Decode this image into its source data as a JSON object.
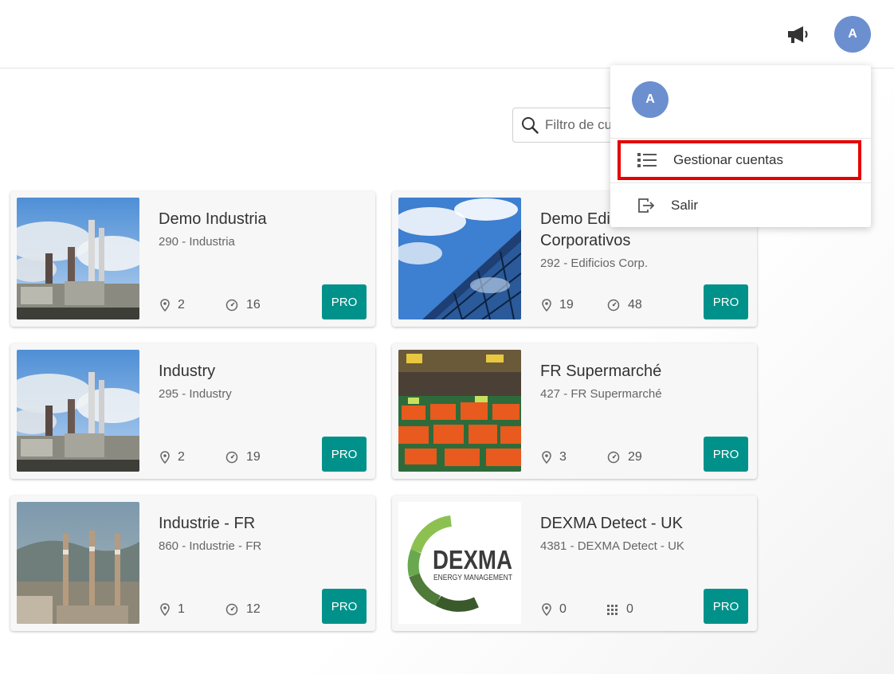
{
  "header": {
    "announcements_icon": "megaphone-icon",
    "avatar_initial": "A",
    "avatar_color": "#6c8fd0"
  },
  "filter": {
    "placeholder": "Filtro de cuentas",
    "value": ""
  },
  "user_menu": {
    "avatar_initial": "A",
    "items": [
      {
        "label": "Gestionar cuentas",
        "icon": "list-icon",
        "highlighted": true
      },
      {
        "label": "Salir",
        "icon": "logout-icon",
        "highlighted": false
      }
    ],
    "highlight_color": "#e60000"
  },
  "accounts": [
    {
      "name": "Demo Industria",
      "subtitle": "290 - Industria",
      "locations": "2",
      "devices": "16",
      "device_icon": "gauge-icon",
      "badge": "PRO",
      "image": "factory-image"
    },
    {
      "name": "Demo Edificios Corporativos",
      "subtitle": "292 - Edificios Corp.",
      "locations": "19",
      "devices": "48",
      "device_icon": "gauge-icon",
      "badge": "PRO",
      "image": "glass-building-image"
    },
    {
      "name": "Industry",
      "subtitle": "295 - Industry",
      "locations": "2",
      "devices": "19",
      "device_icon": "gauge-icon",
      "badge": "PRO",
      "image": "factory-image"
    },
    {
      "name": "FR Supermarché",
      "subtitle": "427 - FR Supermarché",
      "locations": "3",
      "devices": "29",
      "device_icon": "gauge-icon",
      "badge": "PRO",
      "image": "supermarket-image"
    },
    {
      "name": "Industrie - FR",
      "subtitle": "860 - Industrie - FR",
      "locations": "1",
      "devices": "12",
      "device_icon": "gauge-icon",
      "badge": "PRO",
      "image": "chimneys-image"
    },
    {
      "name": "DEXMA Detect - UK",
      "subtitle": "4381 - DEXMA Detect - UK",
      "locations": "0",
      "devices": "0",
      "device_icon": "grid-icon",
      "badge": "PRO",
      "image": "dexma-logo"
    }
  ],
  "dexma_logo": {
    "word": "DEXMA",
    "tagline": "ENERGY MANAGEMENT"
  },
  "colors": {
    "badge": "#00928a",
    "card_bg": "#f7f7f7",
    "text": "#333333"
  }
}
